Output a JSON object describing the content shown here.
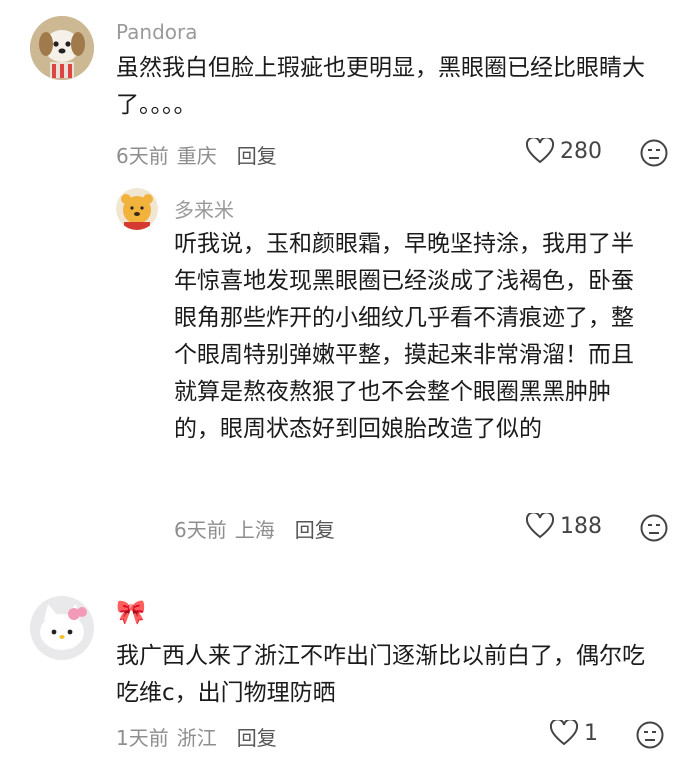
{
  "comments": [
    {
      "user": "Pandora",
      "text": "虽然我白但脸上瑕疵也更明显，黑眼圈已经比眼睛大了。。。。",
      "time": "6天前",
      "location": "重庆",
      "reply": "回复",
      "likes": "280",
      "avatar_icon": "dog-avatar"
    },
    {
      "user": "多来米",
      "text": "听我说，玉和颜眼霜，早晚坚持涂，我用了半年惊喜地发现黑眼圈已经淡成了浅褐色，卧蚕眼角那些炸开的小细纹几乎看不清痕迹了，整个眼周特别弹嫩平整，摸起来非常滑溜！而且就算是熬夜熬狠了也不会整个眼圈黑黑肿肿的，眼周状态好到回娘胎改造了似的",
      "time": "6天前",
      "location": "上海",
      "reply": "回复",
      "likes": "188",
      "avatar_icon": "winnie-the-pooh-avatar"
    },
    {
      "user": "🎀",
      "text": "我广西人来了浙江不咋出门逐渐比以前白了，偶尔吃吃维c，出门物理防晒",
      "time": "1天前",
      "location": "浙江",
      "reply": "回复",
      "likes": "1",
      "avatar_icon": "hello-kitty-avatar"
    }
  ]
}
